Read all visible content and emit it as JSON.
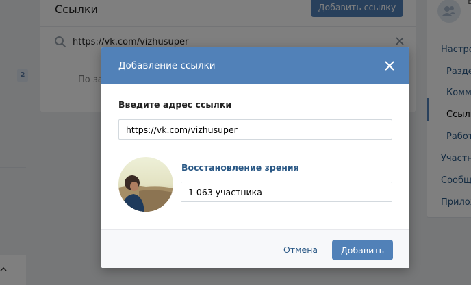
{
  "background": {
    "links_title": "Ссылки",
    "add_link_button": "Добавить ссылку",
    "search_value": "https://vk.com/vizhusuper",
    "empty_text_partial": "По за",
    "left_badge": "2",
    "sidebar": {
      "top_letter": "В",
      "items": [
        "Настро",
        "Разде",
        "Комме",
        "Ссылк",
        "Работ",
        "Участн",
        "Сообще",
        "Прилож"
      ]
    }
  },
  "modal": {
    "title": "Добавление ссылки",
    "field_label": "Введите адрес ссылки",
    "url_value": "https://vk.com/vizhusuper",
    "community_name": "Восстановление зрения",
    "description_value": "1 063 участника",
    "cancel_label": "Отмена",
    "add_label": "Добавить"
  },
  "colors": {
    "accent": "#5181b8",
    "link": "#2a5885",
    "page_bg": "#edeef0"
  },
  "icons": [
    "search-icon",
    "clear-icon",
    "close-icon",
    "community-avatar",
    "users-icon"
  ]
}
